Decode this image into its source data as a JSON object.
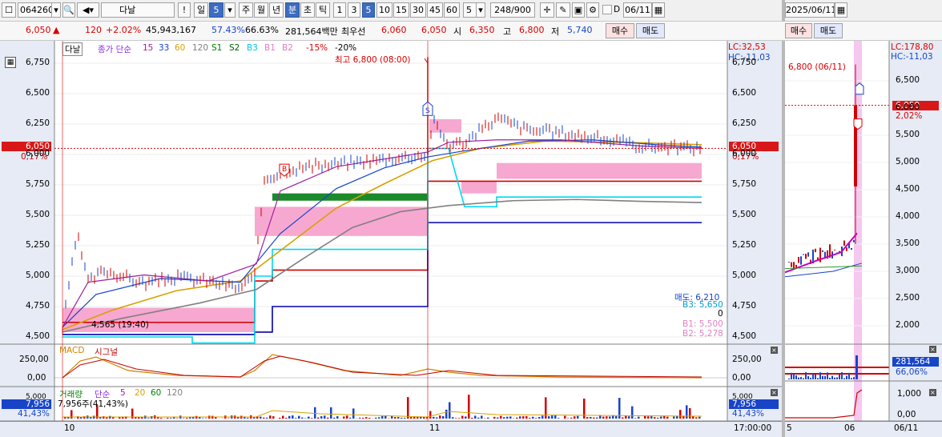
{
  "toolbar": {
    "code": "064260",
    "name": "다날",
    "num_options": "5",
    "last_count": "248/900",
    "date": "06/11",
    "right_date": "2025/06/11",
    "period_labels": [
      "일",
      "5",
      "주",
      "월",
      "년",
      "분",
      "초",
      "틱"
    ],
    "interval_labels": [
      "1",
      "3",
      "5",
      "10",
      "15",
      "30",
      "45",
      "60"
    ],
    "d_label": "D",
    "excl": "!"
  },
  "quote": {
    "price": "6,050",
    "arrow": "▲",
    "change": "120",
    "rate": "+2.02%",
    "volume": "45,943,167",
    "turnover_ratio": "57.43%",
    "ratio2": "66.63%",
    "amount": "281,564백만",
    "prev_label": "최우선",
    "prev_val": "6,060",
    "prev_val2": "6,050",
    "open_label": "시",
    "open": "6,350",
    "high_label": "고",
    "high": "6,800",
    "low_label": "저",
    "low": "5,740",
    "buy_label": "매수",
    "sell_label": "매도"
  },
  "main_chart": {
    "legend_name": "다날",
    "legend_ma": "종가 단순",
    "ma_values": [
      "15",
      "33",
      "60",
      "120"
    ],
    "lines": [
      "S1",
      "S2",
      "B3",
      "B1",
      "B2"
    ],
    "pct": [
      "-15%",
      "-20%"
    ],
    "lc": "LC:32,53",
    "hc": "HC:-11,03",
    "high_note": "최고 6,800 (08:00)",
    "low_note": "4,565 (19:40)",
    "price_tag": "6,050",
    "pct_tag": "0,17%",
    "yticks": [
      "6,750",
      "6,500",
      "6,250",
      "6,000",
      "5,750",
      "5,500",
      "5,250",
      "5,000",
      "4,750",
      "4,500"
    ],
    "rt_labels": [
      "매도: 6,210",
      "B3: 5,650",
      "0",
      "B1: 5,500",
      "B2: 5,278"
    ],
    "marker_s": "S",
    "marker_b": "B"
  },
  "macd": {
    "title": "MACD",
    "signal": "시그널",
    "yticks": [
      "250,00",
      "0,00"
    ]
  },
  "vol": {
    "title": "거래량",
    "ma": "단순",
    "ma_vals": [
      "5",
      "20",
      "60",
      "120"
    ],
    "note": "7,956주(41,43%)",
    "tag": "7,956",
    "pct": "41,43%",
    "top": "5,000"
  },
  "xaxis": {
    "d1": "10",
    "d2": "11",
    "time": "17:00:00"
  },
  "right_chart": {
    "lc": "LC:178,80",
    "hc": "HC:-11,03",
    "high_note": "6,800 (06/11)",
    "price_tag": "6,050",
    "pct_tag": "2,02%",
    "yticks": [
      "6,500",
      "6,000",
      "5,500",
      "5,000",
      "4,500",
      "4,000",
      "3,500",
      "3,000",
      "2,500",
      "2,000"
    ],
    "vol_tag": "281,564",
    "vol_pct": "66,06%",
    "vol_ticks": [
      "1,000",
      "0,00"
    ],
    "x_labels": [
      "5",
      "06",
      "06/11"
    ]
  },
  "colors": {
    "up": "#d80000",
    "down": "#1844c8",
    "accent": "#3d6cc0",
    "axis_bg": "#e6ebf5"
  }
}
